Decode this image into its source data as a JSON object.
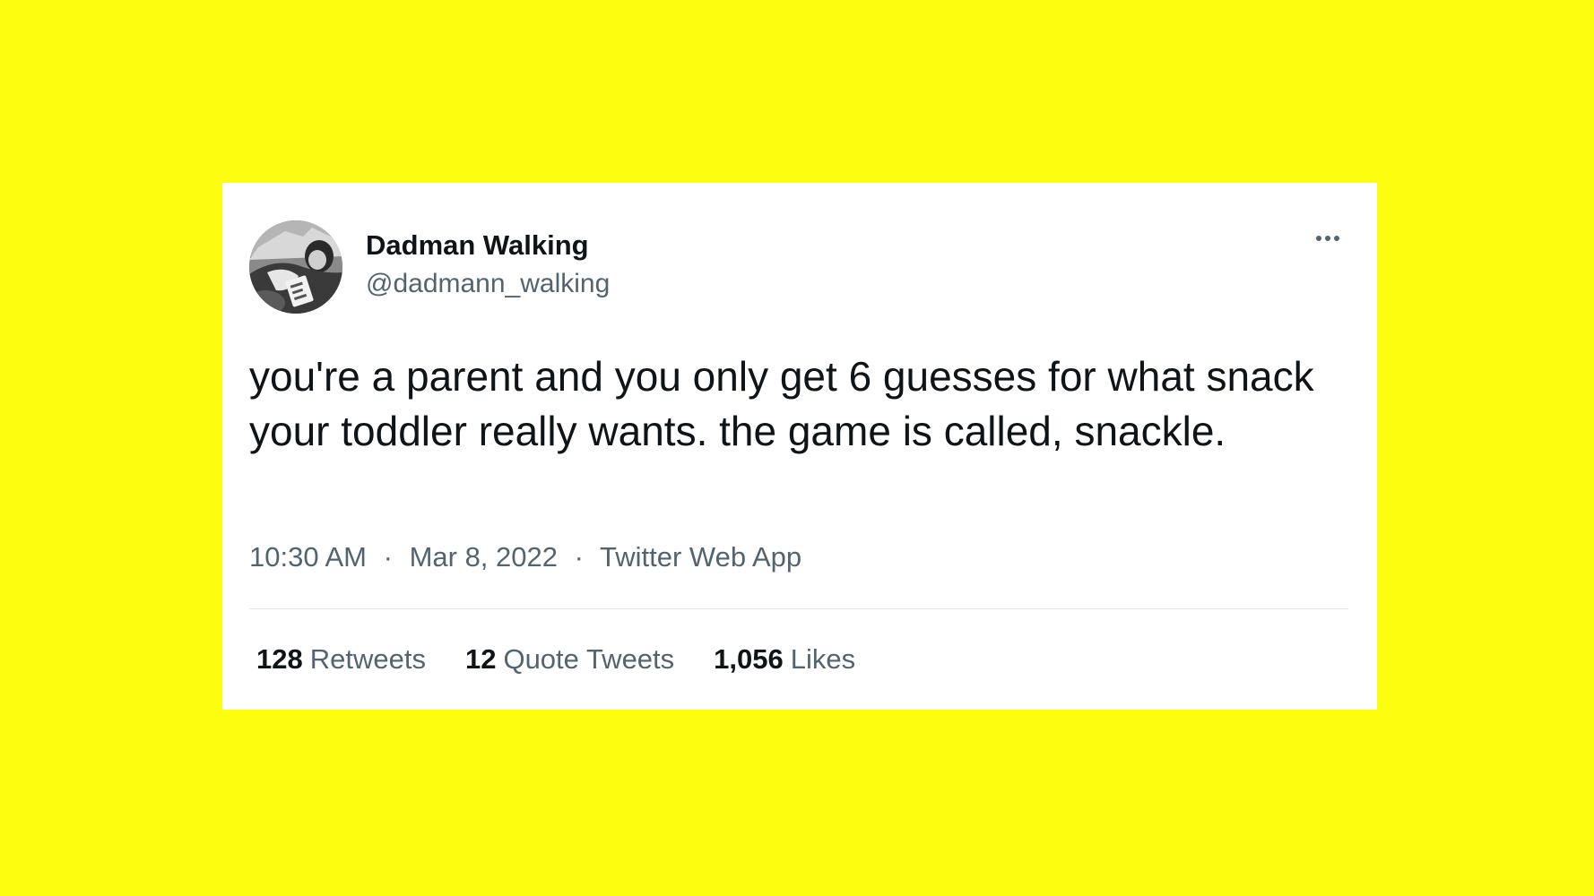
{
  "tweet": {
    "display_name": "Dadman Walking",
    "handle": "@dadmann_walking",
    "text": "you're a parent and you only get 6 guesses for what snack your toddler really wants. the game is called, snackle.",
    "time": "10:30 AM",
    "date": "Mar 8, 2022",
    "source": "Twitter Web App",
    "separator": "·",
    "more_icon": "more-horizontal-icon",
    "avatar": "profile-photo"
  },
  "stats": {
    "retweets_count": "128",
    "retweets_label": "Retweets",
    "quotes_count": "12",
    "quotes_label": "Quote Tweets",
    "likes_count": "1,056",
    "likes_label": "Likes"
  },
  "colors": {
    "background": "#fdfd0f",
    "card": "#ffffff",
    "primary_text": "#0f1419",
    "secondary_text": "#536471",
    "divider": "#e4e8ea"
  }
}
